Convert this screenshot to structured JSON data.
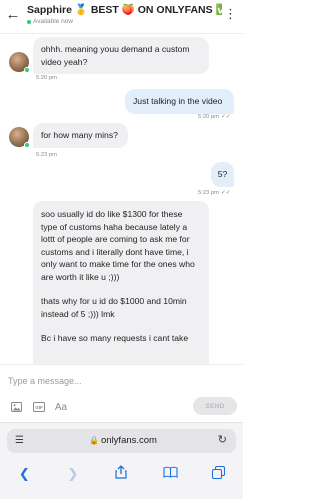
{
  "header": {
    "title": "Sapphire 🥇 BEST 🍑 ON ONLYFANS ✅",
    "status": "Available now",
    "back_icon": "arrow-left-icon",
    "more_icon": "more-vertical-icon"
  },
  "messages": [
    {
      "id": 1,
      "side": "in",
      "text": "ohhh. meaning youu demand a custom video yeah?",
      "time": "5:20 pm"
    },
    {
      "id": 2,
      "side": "out",
      "text": "Just talking in the video",
      "time": "5:20 pm"
    },
    {
      "id": 3,
      "side": "in",
      "text": "for how many mins?",
      "time": "5:23 pm"
    },
    {
      "id": 4,
      "side": "out",
      "text": "5?",
      "time": "5:23 pm"
    },
    {
      "id": 5,
      "side": "in",
      "paragraphs": [
        "soo usually id do like $1300 for these type of customs haha because lately a lottt of people are coming to ask me for customs and i literally dont have time, i only want to make time for the ones who are worth it like u ;)))",
        "thats why for u id do $1000 and 10min instead of 5 ;))) lmk",
        "Bc i have so many requests i cant take"
      ]
    }
  ],
  "composer": {
    "placeholder": "Type a message...",
    "send_label": "SEND",
    "tools": [
      "image-icon",
      "gif-icon",
      "text-format-icon"
    ],
    "text_tool_label": "Aa",
    "gif_label": "GIF"
  },
  "browser": {
    "url": "onlyfans.com",
    "tab_icon": "tabs-icon",
    "lock_icon": "lock-icon",
    "reload_icon": "reload-icon",
    "nav": [
      "back-icon",
      "forward-icon",
      "share-icon",
      "bookmarks-icon",
      "tabs-overview-icon"
    ]
  },
  "colors": {
    "incoming_bubble": "#f0f0f2",
    "outgoing_bubble": "#e3eefb",
    "online": "#2ecc71",
    "browser_accent": "#1e6fe0"
  }
}
